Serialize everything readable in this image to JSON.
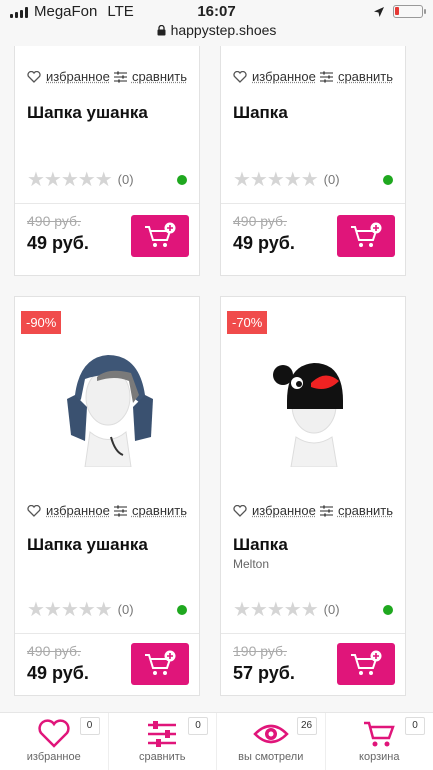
{
  "status_bar": {
    "carrier": "MegaFon",
    "network": "LTE",
    "time": "16:07",
    "url": "happystep.shoes",
    "battery_level": 0.15
  },
  "labels": {
    "favorites": "избранное",
    "compare": "сравнить"
  },
  "products": [
    {
      "title": "Шапка ушанка",
      "brand": "",
      "badge": "",
      "rating_count": "(0)",
      "old_price": "490 руб.",
      "price": "49 руб."
    },
    {
      "title": "Шапка",
      "brand": "",
      "badge": "",
      "rating_count": "(0)",
      "old_price": "490 руб.",
      "price": "49 руб."
    },
    {
      "title": "Шапка ушанка",
      "brand": "",
      "badge": "-90%",
      "rating_count": "(0)",
      "old_price": "490 руб.",
      "price": "49 руб."
    },
    {
      "title": "Шапка",
      "brand": "Melton",
      "badge": "-70%",
      "rating_count": "(0)",
      "old_price": "190 руб.",
      "price": "57 руб."
    }
  ],
  "bottom_nav": [
    {
      "label": "избранное",
      "count": "0",
      "icon": "heart-icon"
    },
    {
      "label": "сравнить",
      "count": "0",
      "icon": "sliders-icon"
    },
    {
      "label": "вы смотрели",
      "count": "26",
      "icon": "eye-icon"
    },
    {
      "label": "корзина",
      "count": "0",
      "icon": "cart-icon"
    }
  ],
  "colors": {
    "accent": "#e0157a",
    "badge": "#f04b4b",
    "in_stock": "#1fa81f"
  }
}
